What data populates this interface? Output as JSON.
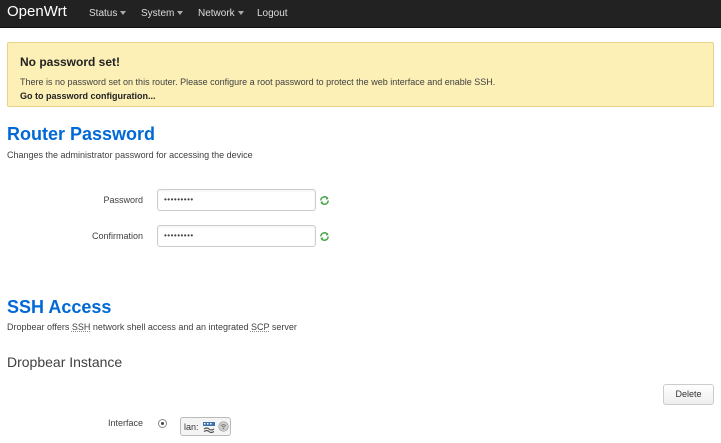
{
  "navbar": {
    "brand": "OpenWrt",
    "items": [
      {
        "label": "Status",
        "dropdown": true
      },
      {
        "label": "System",
        "dropdown": true
      },
      {
        "label": "Network",
        "dropdown": true
      },
      {
        "label": "Logout",
        "dropdown": false
      }
    ]
  },
  "alert": {
    "title": "No password set!",
    "text": "There is no password set on this router. Please configure a root password to protect the web interface and enable SSH.",
    "link": "Go to password configuration..."
  },
  "router_password": {
    "title": "Router Password",
    "description": "Changes the administrator password for accessing the device",
    "password_label": "Password",
    "password_value": "•••••••••",
    "confirmation_label": "Confirmation",
    "confirmation_value": "•••••••••",
    "reveal_icon": "reveal-password-icon"
  },
  "ssh_access": {
    "title": "SSH Access",
    "description_pre": "Dropbear offers ",
    "ssh_abbr": "SSH",
    "description_mid": " network shell access and an integrated ",
    "scp_abbr": "SCP",
    "description_post": " server",
    "instance_title": "Dropbear Instance",
    "delete_label": "Delete",
    "interface_label": "Interface",
    "interface_option": "lan:",
    "interface_icons": [
      "network-icon",
      "wireless-icon"
    ]
  },
  "colors": {
    "navbar": "#222222",
    "heading": "#0069d6",
    "alert_bg": "#fcf0b6",
    "reveal_icon": "#3fa33f"
  }
}
